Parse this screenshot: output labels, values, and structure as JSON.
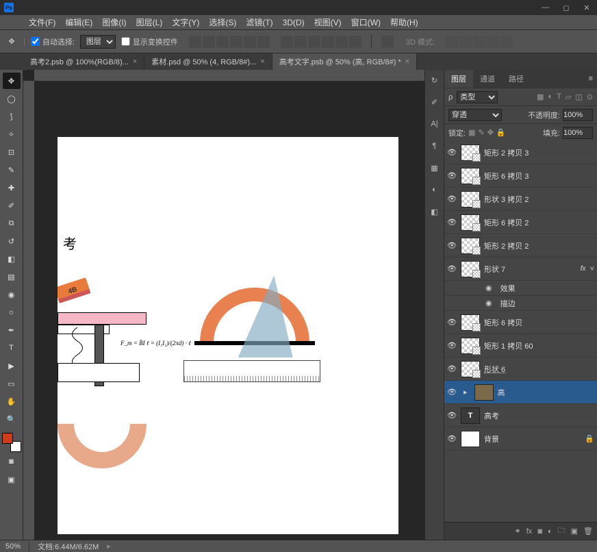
{
  "menu": {
    "file": "文件(F)",
    "edit": "编辑(E)",
    "image": "图像(I)",
    "layer": "图层(L)",
    "type": "文字(Y)",
    "select": "选择(S)",
    "filter": "滤镜(T)",
    "3d": "3D(D)",
    "view": "视图(V)",
    "window": "窗口(W)",
    "help": "帮助(H)"
  },
  "options": {
    "autoselect": "自动选择:",
    "layer_dropdown": "图层",
    "show_transform": "显示变换控件",
    "mode3d_label": "3D 模式:"
  },
  "tabs": [
    {
      "label": "高考2.psb @ 100%(RGB/8)...",
      "active": false
    },
    {
      "label": "素材.psd @ 50% (4, RGB/8#)...",
      "active": false
    },
    {
      "label": "高考文字.psb @ 50% (高, RGB/8#) *",
      "active": true
    }
  ],
  "panel_tabs": {
    "layers": "图层",
    "channels": "通道",
    "paths": "路径"
  },
  "filters": {
    "kind": "类型",
    "blend": "穿透",
    "opacity_label": "不透明度:",
    "opacity_val": "100%",
    "lock_label": "锁定:",
    "fill_label": "填充:",
    "fill_val": "100%"
  },
  "layers": [
    {
      "name": "矩形 2 拷贝 3",
      "type": "shape"
    },
    {
      "name": "矩形 6 拷贝 3",
      "type": "shape"
    },
    {
      "name": "形状 3 拷贝 2",
      "type": "shape"
    },
    {
      "name": "矩形 6 拷贝 2",
      "type": "shape"
    },
    {
      "name": "矩形 2 拷贝 2",
      "type": "shape"
    },
    {
      "name": "形状 7",
      "type": "shape",
      "fx": true
    },
    {
      "name": "效果",
      "type": "fxsub"
    },
    {
      "name": "描边",
      "type": "fxsub"
    },
    {
      "name": "矩形 6 拷贝",
      "type": "shape"
    },
    {
      "name": "矩形 1 拷贝 60",
      "type": "shape"
    },
    {
      "name": "形状 6",
      "type": "shape",
      "underline": true
    },
    {
      "name": "高",
      "type": "group",
      "selected": true
    },
    {
      "name": "高考",
      "type": "text"
    },
    {
      "name": "背景",
      "type": "solid",
      "locked": true
    }
  ],
  "status": {
    "zoom": "50%",
    "docinfo": "文档:6.44M/6.62M"
  },
  "canvas": {
    "eraser": "4B",
    "char": "考",
    "formula": "F_m = B̄I ℓ = (I₁I₂)/(2πd) · ℓ"
  }
}
